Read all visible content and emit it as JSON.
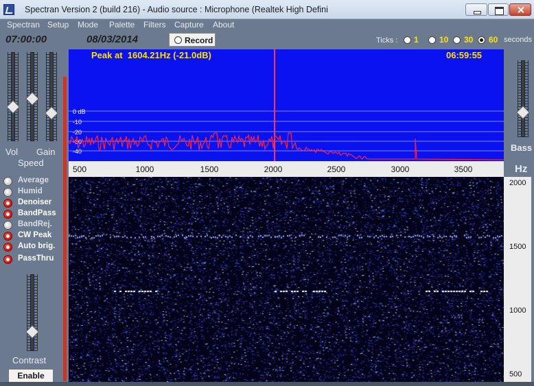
{
  "window": {
    "title": "Spectran Version 2 (build 216) - Audio source  :  Microphone (Realtek High Defini"
  },
  "menu": [
    "Spectran",
    "Setup",
    "Mode",
    "Palette",
    "Filters",
    "Capture",
    "About"
  ],
  "header": {
    "time": "07:00:00",
    "date": "08/03/2014",
    "record_label": "Record",
    "ticks_label": "Ticks :",
    "tick_options": [
      "1",
      "10",
      "30",
      "60"
    ],
    "tick_selected": "60",
    "seconds_label": "seconds"
  },
  "left_panel": {
    "vol_label": "Vol",
    "gain_label": "Gain",
    "speed_label": "Speed",
    "contrast_label": "Contrast",
    "enable_label": "Enable",
    "filters": [
      {
        "label": "Average",
        "on": false
      },
      {
        "label": "Humid",
        "on": false
      },
      {
        "label": "Denoiser",
        "on": true
      },
      {
        "label": "BandPass",
        "on": true
      },
      {
        "label": "BandRej.",
        "on": false
      },
      {
        "label": "CW Peak",
        "on": true
      },
      {
        "label": "Auto brig.",
        "on": true
      },
      {
        "label": "PassThru",
        "on": true
      }
    ]
  },
  "spectrum": {
    "peak_text": "Peak at  1604.21Hz (-21.0dB)",
    "clock": "06:59:55",
    "db_labels": [
      "0 dB",
      "-10",
      "-20",
      "-30",
      "-40"
    ],
    "freq_labels": [
      "500",
      "1000",
      "1500",
      "2000",
      "2500",
      "3000",
      "3500"
    ]
  },
  "right_panel": {
    "bass_label": "Bass",
    "hz_label": "Hz",
    "waterfall_labels": [
      "2000",
      "1500",
      "1000",
      "500"
    ]
  },
  "colors": {
    "background": "#6c7a90",
    "spectrum_bg": "#0a12f0",
    "trace": "#ff2040",
    "accent_text": "#ffe300",
    "waterfall_bg": "#03031a"
  }
}
